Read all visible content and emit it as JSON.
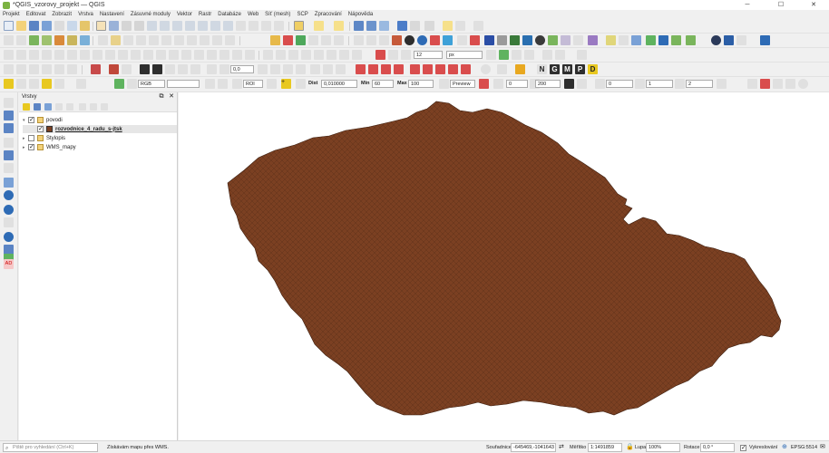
{
  "window": {
    "title": "*QGIS_vzorovy_projekt — QGIS",
    "minimize": "─",
    "maximize": "☐",
    "close": "✕"
  },
  "menu": [
    "Projekt",
    "Editovat",
    "Zobrazit",
    "Vrstva",
    "Nastavení",
    "Zásuvné moduly",
    "Vektor",
    "Rastr",
    "Databáze",
    "Web",
    "Síť (mesh)",
    "SCP",
    "Zpracování",
    "Nápověda"
  ],
  "toolbar": {
    "font_size_value": "12",
    "font_unit": "px",
    "rgb_label": "RGB",
    "zero_value": "0,0",
    "roi_label": "ROI",
    "dist_label": "Dist",
    "dist_value": "0,010000",
    "min_label": "Min",
    "min_value": "60",
    "max_label": "Max",
    "max_value": "100",
    "preview_label": "Preview",
    "range_from": "0",
    "range_to": "200",
    "band1": "0",
    "band2": "1",
    "band3": "2",
    "band_sep": "1",
    "band_add": "+",
    "ng_letters": [
      "N",
      "G",
      "M",
      "P",
      "D"
    ]
  },
  "layers_panel": {
    "title": "Vrstvy",
    "items": [
      {
        "label": "povodi",
        "checked": true,
        "type": "group"
      },
      {
        "label": "rozvodnice_4_radu_s-jtsk",
        "checked": true,
        "type": "layer"
      },
      {
        "label": "Stylopis",
        "checked": false,
        "type": "group"
      },
      {
        "label": "WMS_mapy",
        "checked": true,
        "type": "group"
      }
    ]
  },
  "map": {
    "fill_color": "#7b4022",
    "stroke_color": "#3b1d0e",
    "background": "#ffffff"
  },
  "statusbar": {
    "locator_placeholder": "Piště pro vyhledání (Ctrl+K)",
    "message": "Získávám mapu přes WMS.",
    "coord_label": "Souřadnice",
    "coord_value": "-645469,-1041643",
    "scale_label": "Měřítko",
    "scale_value": "1:1491859",
    "magnifier_label": "Lupa",
    "magnifier_value": "100%",
    "rotation_label": "Rotace",
    "rotation_value": "0,0 °",
    "render_label": "Vykreslování",
    "crs_label": "EPSG:5514"
  }
}
